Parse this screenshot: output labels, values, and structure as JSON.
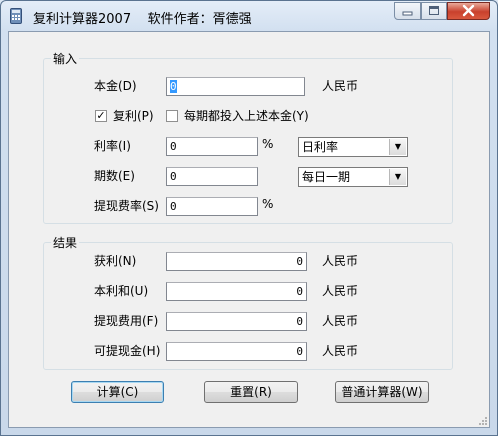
{
  "window": {
    "title": "复利计算器2007    软件作者：胥德强",
    "title_app": "复利计算器2007",
    "title_author": "软件作者：胥德强"
  },
  "input_group": {
    "legend": "输入",
    "principal": {
      "label": "本金(D)",
      "value": "0",
      "unit": "人民币"
    },
    "compound_checkbox": {
      "label": "复利(P)",
      "checked": true
    },
    "invest_each_checkbox": {
      "label": "每期都投入上述本金(Y)",
      "checked": false
    },
    "rate": {
      "label": "利率(I)",
      "value": "0",
      "unit": "%",
      "period_select": "日利率"
    },
    "periods": {
      "label": "期数(E)",
      "value": "0",
      "period_select": "每日一期"
    },
    "withdraw_fee_rate": {
      "label": "提现费率(S)",
      "value": "0",
      "unit": "%"
    }
  },
  "result_group": {
    "legend": "结果",
    "profit": {
      "label": "获利(N)",
      "value": "0",
      "unit": "人民币"
    },
    "total": {
      "label": "本利和(U)",
      "value": "0",
      "unit": "人民币"
    },
    "withdraw_fee": {
      "label": "提现费用(F)",
      "value": "0",
      "unit": "人民币"
    },
    "withdrawable": {
      "label": "可提现金(H)",
      "value": "0",
      "unit": "人民币"
    }
  },
  "buttons": {
    "calculate": "计算(C)",
    "reset": "重置(R)",
    "normal_calculator": "普通计算器(W)"
  },
  "colors": {
    "title_bar": "#d2e0f0",
    "client": "#f0f0f0",
    "close_button": "#c9412d",
    "selection": "#3399ff"
  }
}
